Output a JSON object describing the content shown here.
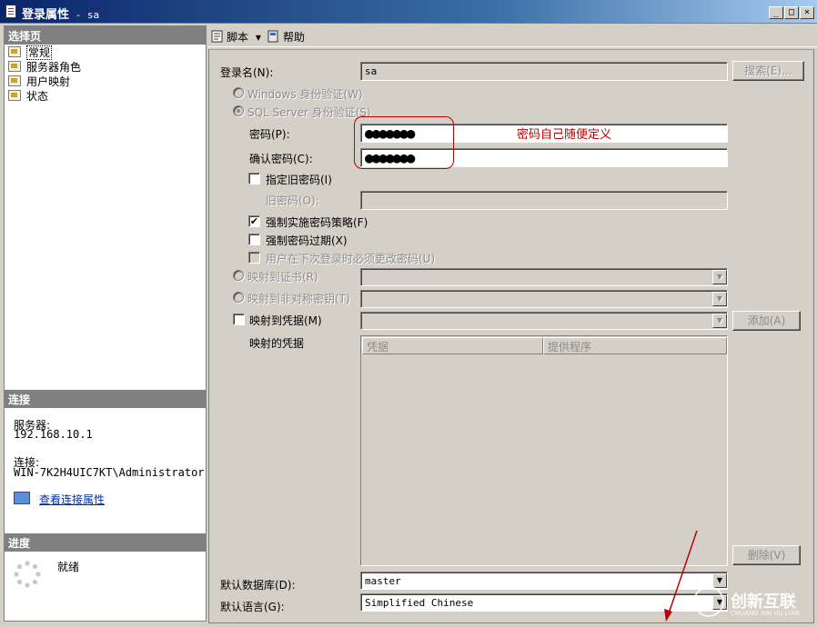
{
  "window": {
    "title_prefix": "登录属性",
    "title_suffix": " - sa",
    "minimize_glyph": "_",
    "maximize_glyph": "□",
    "close_glyph": "×"
  },
  "left": {
    "select_page_header": "选择页",
    "nav_items": [
      "常规",
      "服务器角色",
      "用户映射",
      "状态"
    ],
    "connection_header": "连接",
    "server_label": "服务器:",
    "server_value": "192.168.10.1",
    "connection_label": "连接:",
    "connection_value": "WIN-7K2H4UIC7KT\\Administrator",
    "view_link": "查看连接属性",
    "progress_header": "进度",
    "progress_status": "就绪"
  },
  "toolbar": {
    "script_label": "脚本",
    "dropdown_glyph": "▾",
    "help_label": "帮助"
  },
  "form": {
    "login_name_label": "登录名(N):",
    "login_name_value": "sa",
    "search_button": "搜索(E)...",
    "windows_auth_label": "Windows 身份验证(W)",
    "sql_auth_label": "SQL Server 身份验证(S)",
    "password_label": "密码(P):",
    "password_value": "●●●●●●●",
    "confirm_password_label": "确认密码(C):",
    "confirm_password_value": "●●●●●●●",
    "annotation": "密码自己随便定义",
    "specify_old_label": "指定旧密码(I)",
    "old_password_label": "旧密码(O):",
    "enforce_policy_label": "强制实施密码策略(F)",
    "enforce_policy_check": "✔",
    "enforce_expiry_label": "强制密码过期(X)",
    "must_change_label": "用户在下次登录时必须更改密码(U)",
    "map_cert_label": "映射到证书(R)",
    "map_asym_label": "映射到非对称密钥(T)",
    "map_cred_label": "映射到凭据(M)",
    "add_button": "添加(A)",
    "mapped_creds_label": "映射的凭据",
    "col_credential": "凭据",
    "col_provider": "提供程序",
    "remove_button": "删除(V)",
    "default_db_label": "默认数据库(D):",
    "default_db_value": "master",
    "default_lang_label": "默认语言(G):",
    "default_lang_value": "Simplified Chinese",
    "dropdown_glyph": "▼"
  },
  "watermark": {
    "text": "创新互联",
    "subtext": "CHUANG XIN HU LIAN"
  },
  "colors": {
    "annotation": "#c00000",
    "titlebar_start": "#0a246a",
    "link": "#00309c"
  }
}
